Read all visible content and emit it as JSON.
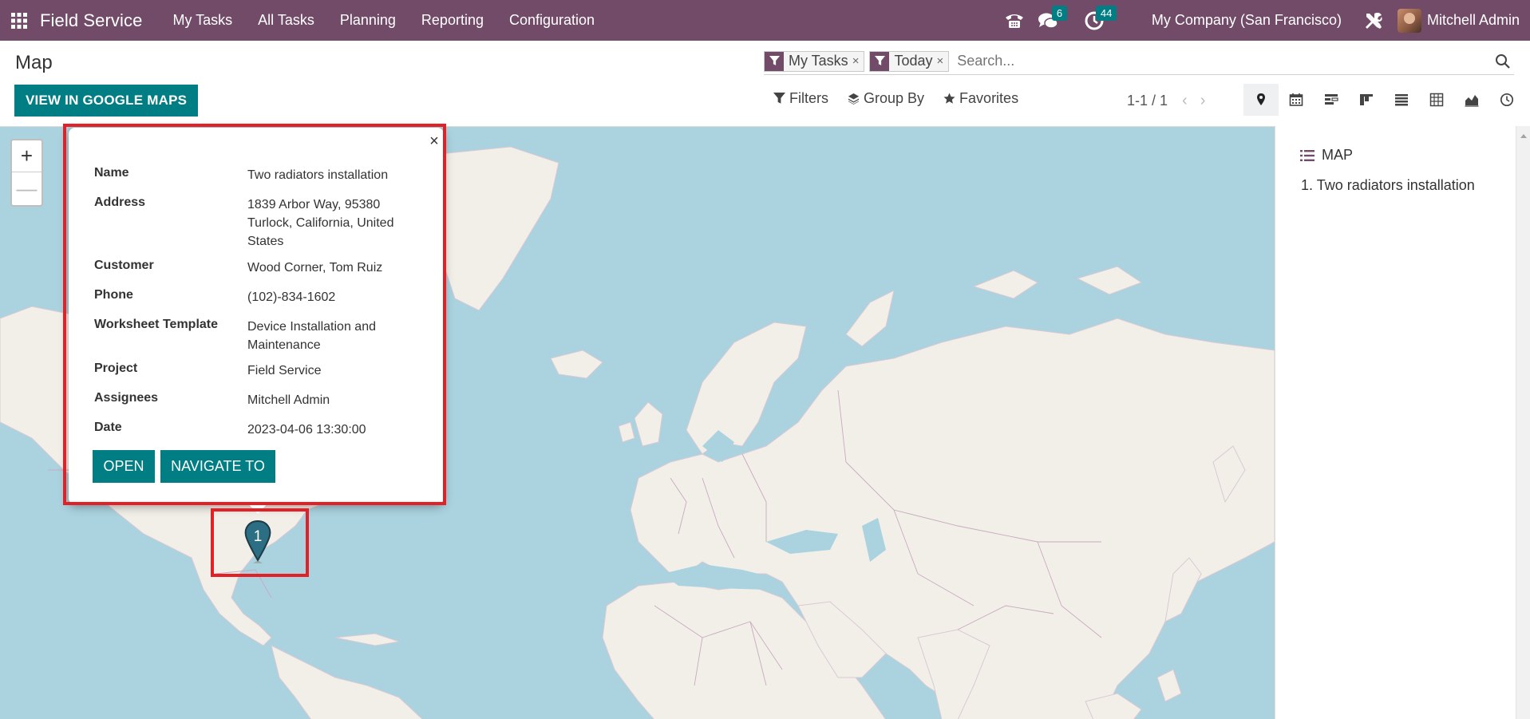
{
  "navbar": {
    "app_name": "Field Service",
    "menu": [
      "My Tasks",
      "All Tasks",
      "Planning",
      "Reporting",
      "Configuration"
    ],
    "messages_count": "6",
    "activities_count": "44",
    "company": "My Company (San Francisco)",
    "user_name": "Mitchell Admin"
  },
  "control_panel": {
    "title": "Map",
    "primary_button": "VIEW IN GOOGLE MAPS",
    "facets": [
      {
        "label": "My Tasks",
        "close": "×"
      },
      {
        "label": "Today",
        "close": "×"
      }
    ],
    "search_placeholder": "Search...",
    "filters_label": "Filters",
    "group_by_label": "Group By",
    "favorites_label": "Favorites",
    "pager": "1-1 / 1",
    "pager_prev": "‹",
    "pager_next": "›",
    "views": [
      "map-icon",
      "calendar-icon",
      "gantt-icon",
      "kanban-icon",
      "list-icon",
      "pivot-icon",
      "graph-icon",
      "activity-icon"
    ]
  },
  "map": {
    "zoom_in": "+",
    "zoom_out": "—",
    "popup": {
      "close": "×",
      "fields": [
        {
          "label": "Name",
          "value": "Two radiators installation"
        },
        {
          "label": "Address",
          "value": "1839 Arbor Way, 95380 Turlock, California, United States"
        },
        {
          "label": "Customer",
          "value": "Wood Corner, Tom Ruiz"
        },
        {
          "label": "Phone",
          "value": "(102)-834-1602"
        },
        {
          "label": "Worksheet Template",
          "value": "Device Installation and Maintenance"
        },
        {
          "label": "Project",
          "value": "Field Service"
        },
        {
          "label": "Assignees",
          "value": "Mitchell Admin"
        },
        {
          "label": "Date",
          "value": "2023-04-06 13:30:00"
        }
      ],
      "open_button": "OPEN",
      "navigate_button": "NAVIGATE TO"
    },
    "marker_number": "1"
  },
  "side_panel": {
    "title": "MAP",
    "items": [
      "1. Two radiators installation"
    ]
  },
  "colors": {
    "navbar": "#714b67",
    "primary": "#017e84",
    "water": "#aad3df",
    "land": "#f2efe9",
    "highlight": "#e32025"
  }
}
